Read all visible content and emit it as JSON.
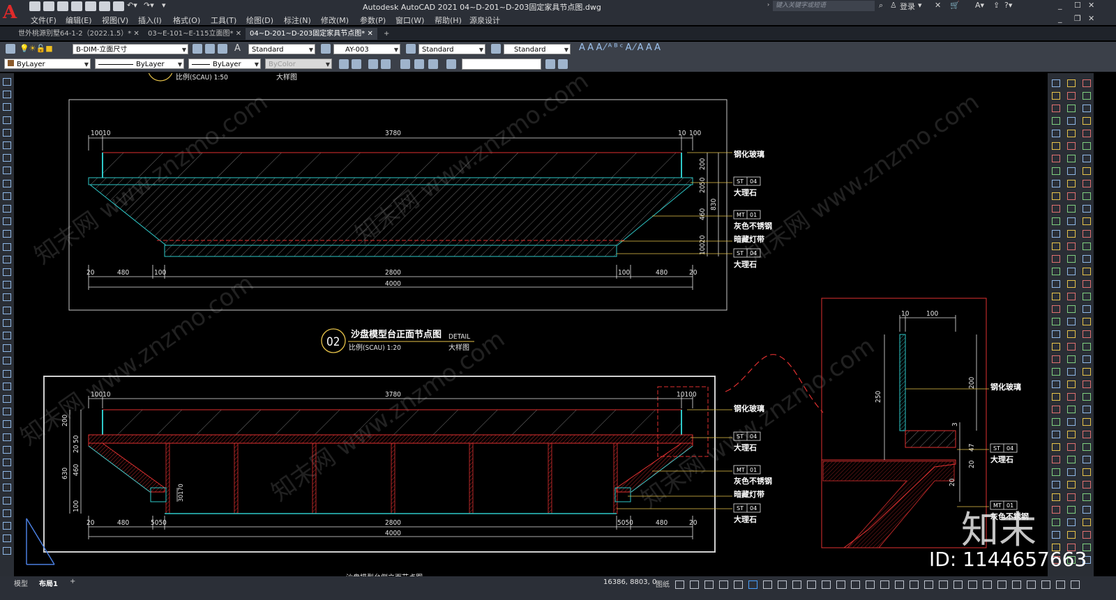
{
  "window": {
    "title": "Autodesk AutoCAD 2021    04~D-201~D-203固定家具节点图.dwg",
    "search_placeholder": "键入关键字或短语",
    "login": "登录",
    "min_max_close": [
      "_",
      "☐",
      "✕"
    ]
  },
  "menu": [
    "文件(F)",
    "编辑(E)",
    "视图(V)",
    "插入(I)",
    "格式(O)",
    "工具(T)",
    "绘图(D)",
    "标注(N)",
    "修改(M)",
    "参数(P)",
    "窗口(W)",
    "帮助(H)",
    "源泉设计"
  ],
  "tabs": [
    {
      "label": "世外桃源别墅64-1-2（2022.1.5）*",
      "active": false
    },
    {
      "label": "03~E-101~E-115立面图*",
      "active": false
    },
    {
      "label": "04~D-201~D-203固定家具节点图*",
      "active": true
    }
  ],
  "toolbar": {
    "layer": "B-DIM-立面尺寸",
    "text_style": "Standard",
    "dim_style": "AY-003",
    "table_style": "Standard",
    "mleader_style": "Standard",
    "color": "ByLayer",
    "linetype": "ByLayer",
    "lineweight": "ByLayer",
    "plot_style": "ByColor"
  },
  "drawing": {
    "top_scale_label": "比例(SCAU) 1:50",
    "top_detail_label": "大样图",
    "view1": {
      "dims_top": [
        "10010",
        "3780",
        "10",
        "100"
      ],
      "dims_bottom": [
        "20",
        "480",
        "100",
        "2800",
        "100",
        "480",
        "20"
      ],
      "total": "4000",
      "dims_right": [
        "200",
        "20",
        "50",
        "830",
        "460",
        "20",
        "100"
      ]
    },
    "title2": {
      "number": "02",
      "name": "沙盘模型台正面节点图",
      "scale": "比例(SCAU) 1:20",
      "detail": "DETAIL",
      "detail_cn": "大样图"
    },
    "view2": {
      "dims_top": [
        "10010",
        "3780",
        "10100"
      ],
      "dims_bottom": [
        "20",
        "480",
        "5050",
        "2800",
        "5050",
        "480",
        "20"
      ],
      "total": "4000",
      "dims_left": [
        "200",
        "50",
        "20",
        "630",
        "460",
        "100"
      ],
      "inner_dim": "30170"
    },
    "detail_view": {
      "dims_top": [
        "10",
        "100"
      ],
      "dims": [
        "250",
        "200",
        "3",
        "47",
        "20",
        "20"
      ]
    },
    "annotations_v1": [
      {
        "code": "",
        "num": "",
        "text": "钢化玻璃"
      },
      {
        "code": "ST",
        "num": "04",
        "text": "大理石"
      },
      {
        "code": "MT",
        "num": "01",
        "text": "灰色不锈钢"
      },
      {
        "code": "",
        "num": "",
        "text": "暗藏灯带"
      },
      {
        "code": "ST",
        "num": "04",
        "text": "大理石"
      }
    ],
    "annotations_v2": [
      {
        "code": "",
        "num": "",
        "text": "钢化玻璃"
      },
      {
        "code": "ST",
        "num": "04",
        "text": "大理石"
      },
      {
        "code": "MT",
        "num": "01",
        "text": "灰色不锈钢"
      },
      {
        "code": "",
        "num": "",
        "text": "暗藏灯带"
      },
      {
        "code": "ST",
        "num": "04",
        "text": "大理石"
      }
    ],
    "annotations_detail": [
      {
        "code": "",
        "num": "",
        "text": "钢化玻璃"
      },
      {
        "code": "ST",
        "num": "04",
        "text": "大理石"
      },
      {
        "code": "MT",
        "num": "01",
        "text": "灰色不锈钢"
      }
    ],
    "watermark": "知末网 www.znzmo.com"
  },
  "status": {
    "model_tab": "模型",
    "layout_tab": "布局1",
    "add_tab": "+",
    "coords": "16386, 8803, 0",
    "paper_label": "图纸"
  },
  "overlay": {
    "logo": "知末",
    "id": "ID: 1144657663"
  },
  "colors": {
    "red": "#e03030",
    "cyan": "#2ec8c8",
    "white": "#e6e6e6",
    "yellow": "#e8c44a",
    "frame": "#c8c8c8"
  }
}
